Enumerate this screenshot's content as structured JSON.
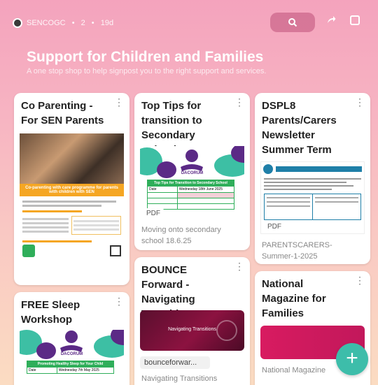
{
  "header": {
    "author": "SENCOGC",
    "count": "2",
    "age": "19d",
    "title": "Support for Children and Families",
    "subtitle": "A one stop shop to help signpost you to the right support and services."
  },
  "cards": {
    "co_parenting": {
      "title": "Co Parenting - For SEN Parents",
      "banner": "Co-parenting with care programme for parents with children with SEN"
    },
    "top_tips": {
      "title": "Top Tips for transition to Secondary School",
      "logo_text": "DACORUM",
      "table_title": "Top Tips for Transition to Secondary School",
      "row1_label": "Date",
      "row1_value": "Wednesday 18th June 2025",
      "pdf": "PDF",
      "caption": "Moving onto secondary school 18.6.25"
    },
    "dspl8": {
      "title": "DSPL8 Parents/Carers Newsletter Summer Term",
      "pdf": "PDF",
      "caption": "PARENTSCARERS-Summer-1-2025"
    },
    "free_sleep": {
      "title": "FREE Sleep Workshop",
      "logo_text": "DACORUM",
      "table_title": "Promoting Healthy Sleep for Your Child",
      "row1_label": "Date",
      "row1_value": "Wednesday 7th May 2025"
    },
    "bounce": {
      "title": "BOUNCE Forward - Navigating Transitions",
      "thumb_text": "Navigating Transitions",
      "link": "bounceforwar...",
      "caption": "Navigating Transitions"
    },
    "national": {
      "title": "National Magazine for Families",
      "caption": "National Magazine"
    }
  },
  "colors": {
    "accent": "#3dbdaa",
    "purple": "#5b2a86",
    "teal": "#3dbfa4",
    "magenta": "#c2185b",
    "green": "#2fae5a"
  },
  "icons": {
    "search": "search-icon",
    "share": "share-icon",
    "edit": "edit-icon",
    "more": "more-vertical-icon",
    "add": "plus-icon"
  },
  "fab_label": "+"
}
